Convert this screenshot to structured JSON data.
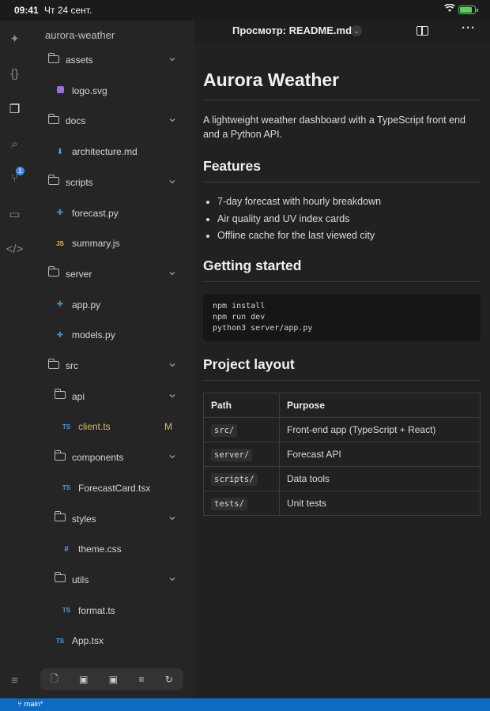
{
  "status_bar": {
    "time": "09:41",
    "date": "Чт 24 сент.",
    "battery_level": 0.9
  },
  "activity_bar": {
    "items": [
      {
        "name": "sparkle-icon",
        "glyph": "✦"
      },
      {
        "name": "braces-icon",
        "glyph": "{}"
      },
      {
        "name": "files-icon",
        "glyph": "❐"
      },
      {
        "name": "search-icon",
        "glyph": "⌕"
      },
      {
        "name": "source-control-icon",
        "glyph": "⑂",
        "badge": "1"
      },
      {
        "name": "remote-monitor-icon",
        "glyph": "▭"
      },
      {
        "name": "code-icon",
        "glyph": "</>"
      },
      {
        "name": "settings-sliders-icon",
        "glyph": "≡"
      }
    ]
  },
  "sidebar": {
    "project": "aurora-weather",
    "tree": [
      {
        "label": "assets",
        "type": "folder",
        "depth": 0
      },
      {
        "label": "logo.svg",
        "type": "svg",
        "depth": 1
      },
      {
        "label": "docs",
        "type": "folder",
        "depth": 0
      },
      {
        "label": "architecture.md",
        "type": "md",
        "depth": 1
      },
      {
        "label": "scripts",
        "type": "folder",
        "depth": 0
      },
      {
        "label": "forecast.py",
        "type": "py",
        "depth": 1
      },
      {
        "label": "summary.js",
        "type": "js",
        "depth": 1
      },
      {
        "label": "server",
        "type": "folder",
        "depth": 0
      },
      {
        "label": "app.py",
        "type": "py",
        "depth": 1
      },
      {
        "label": "models.py",
        "type": "py",
        "depth": 1
      },
      {
        "label": "src",
        "type": "folder",
        "depth": 0
      },
      {
        "label": "api",
        "type": "folder",
        "depth": 1
      },
      {
        "label": "client.ts",
        "type": "ts",
        "depth": 2,
        "modified": "M"
      },
      {
        "label": "components",
        "type": "folder",
        "depth": 1
      },
      {
        "label": "ForecastCard.tsx",
        "type": "ts",
        "depth": 2
      },
      {
        "label": "styles",
        "type": "folder",
        "depth": 1
      },
      {
        "label": "theme.css",
        "type": "css",
        "depth": 2
      },
      {
        "label": "utils",
        "type": "folder",
        "depth": 1
      },
      {
        "label": "format.ts",
        "type": "ts",
        "depth": 2
      },
      {
        "label": "App.tsx",
        "type": "ts",
        "depth": 1
      }
    ],
    "toolbar": [
      {
        "name": "new-file-icon",
        "glyph": "🗋"
      },
      {
        "name": "new-folder-icon",
        "glyph": "▣"
      },
      {
        "name": "folder-settings-icon",
        "glyph": "▣"
      },
      {
        "name": "sort-icon",
        "glyph": "≡"
      },
      {
        "name": "refresh-icon",
        "glyph": "↻"
      }
    ]
  },
  "editor": {
    "title": "Просмотр: README.md"
  },
  "preview": {
    "h1": "Aurora Weather",
    "intro": "A lightweight weather dashboard with a TypeScript front end and a Python API.",
    "features_heading": "Features",
    "features": [
      "7-day forecast with hourly breakdown",
      "Air quality and UV index cards",
      "Offline cache for the last viewed city"
    ],
    "getting_started_heading": "Getting started",
    "code_lines": [
      "npm install",
      "npm run dev",
      "python3 server/app.py"
    ],
    "layout_heading": "Project layout",
    "table": {
      "headers": [
        "Path",
        "Purpose"
      ],
      "rows": [
        [
          "src/",
          "Front-end app (TypeScript + React)"
        ],
        [
          "server/",
          "Forecast API"
        ],
        [
          "scripts/",
          "Data tools"
        ],
        [
          "tests/",
          "Unit tests"
        ]
      ]
    }
  },
  "footer": {
    "branch": "main*"
  }
}
